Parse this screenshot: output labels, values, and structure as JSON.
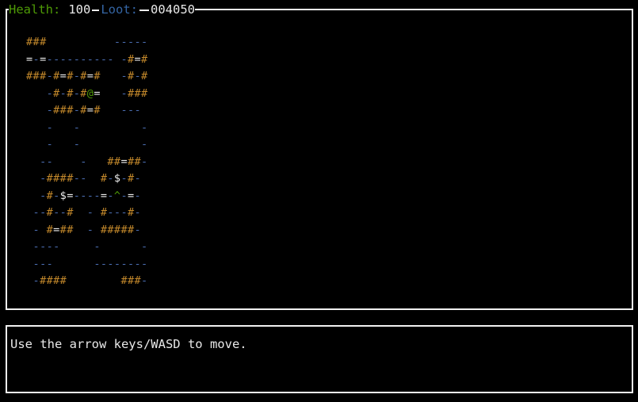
{
  "status": {
    "health_label": "Health:",
    "health_value": "100",
    "loot_label": "Loot:",
    "loot_value": "004050"
  },
  "map": {
    "rows": [
      "###          -----",
      "=-=---------- -#=#",
      "###-#=#-#=#   -#-#",
      "   -#-#-#@=   -###",
      "   -###-#=#   ---",
      "   -   -         -",
      "   -   -         -",
      "  --    -   ##=##-",
      "  -####--  #-$-#-",
      "  -#-$=----=-^-=-",
      " --#--#  - #---#-",
      " - #=##  - #####-",
      " ----     -      -",
      " ---      --------",
      " -####        ###-"
    ],
    "legend": {
      "#": "wall",
      "=": "door",
      "-": "floor",
      "@": "player",
      "$": "loot",
      "^": "trap"
    }
  },
  "colors": {
    "wall": "#c4892b",
    "floor": "#4a6cb0",
    "door": "#eeeeee",
    "player": "#4e9a06",
    "loot": "#eeeeee",
    "trap": "#4e9a06",
    "health_label": "#4e9a06",
    "loot_label": "#3465a4",
    "frame": "#f0f0f0",
    "background": "#000000"
  },
  "message": {
    "text": "Use the arrow keys/WASD to move."
  }
}
